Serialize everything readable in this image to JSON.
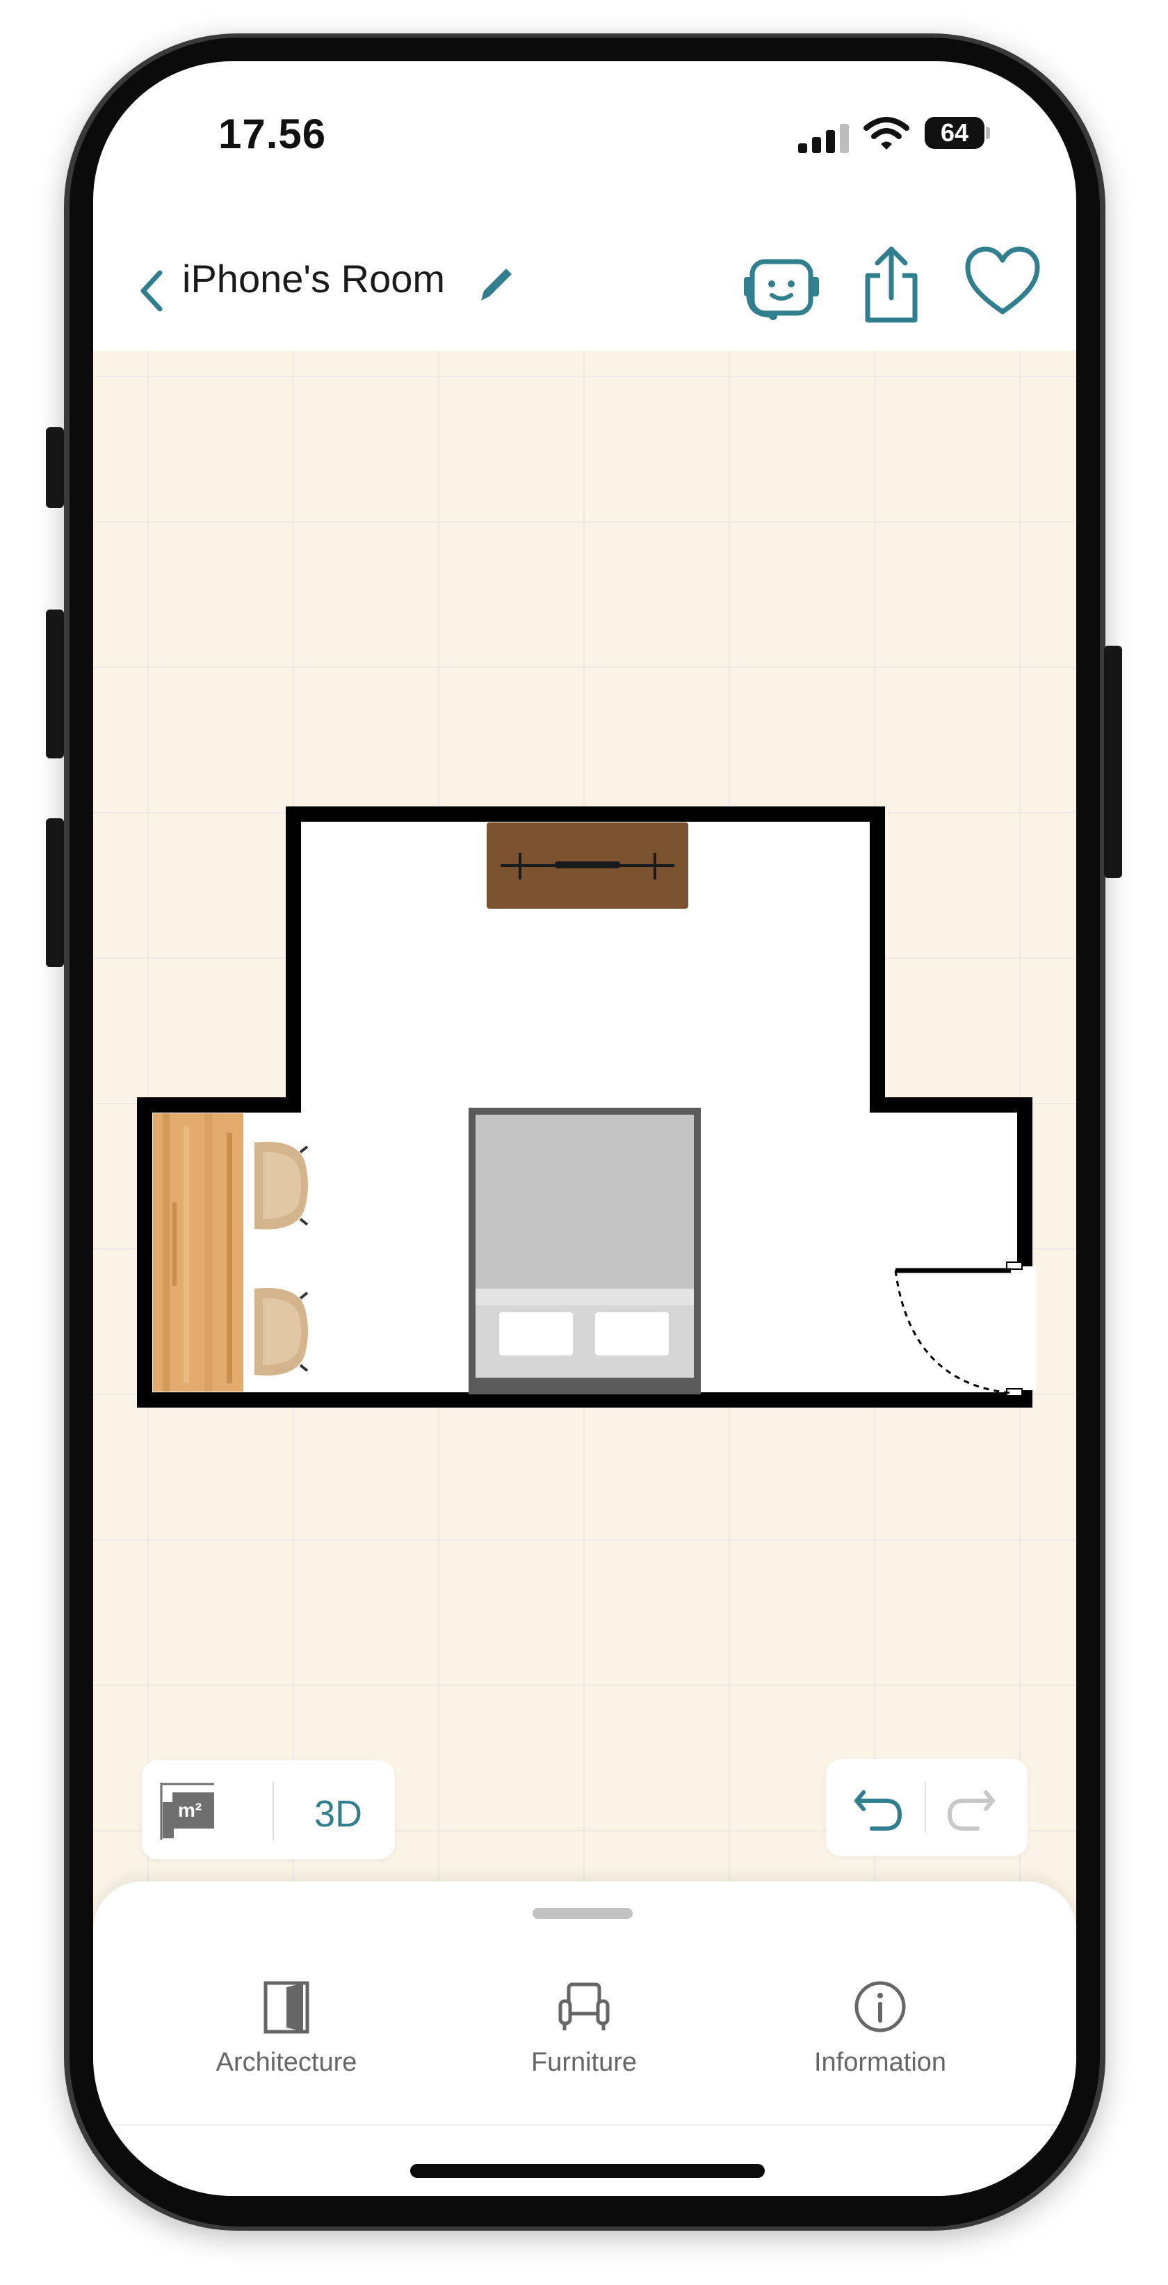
{
  "status_bar": {
    "time": "17.56",
    "battery": "64"
  },
  "nav": {
    "title": "iPhone's Room"
  },
  "controls": {
    "area_unit": "m²",
    "view_3d": "3D"
  },
  "tabs": [
    {
      "label": "Architecture",
      "icon": "door-icon"
    },
    {
      "label": "Furniture",
      "icon": "armchair-icon"
    },
    {
      "label": "Information",
      "icon": "info-icon"
    }
  ],
  "colors": {
    "accent": "#2f7f8f",
    "canvas": "#fbf4e6",
    "wall": "#000000"
  }
}
